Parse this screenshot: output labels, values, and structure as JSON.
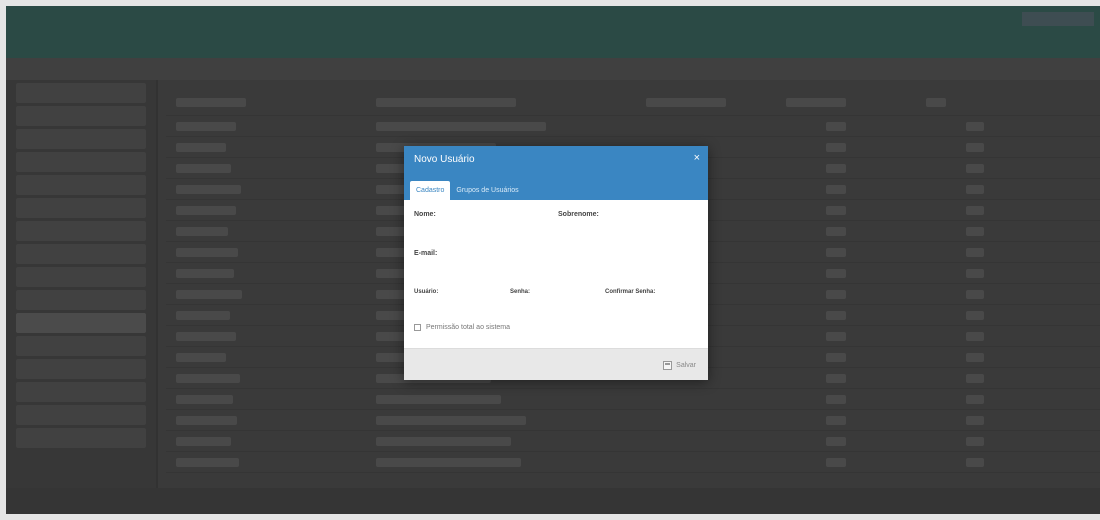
{
  "modal": {
    "title": "Novo Usuário",
    "close_glyph": "×",
    "tabs": [
      {
        "label": "Cadastro",
        "active": true
      },
      {
        "label": "Grupos de Usuários",
        "active": false
      }
    ],
    "fields": {
      "nome": {
        "label": "Nome:",
        "value": ""
      },
      "sobrenome": {
        "label": "Sobrenome:",
        "value": ""
      },
      "email": {
        "label": "E-mail:",
        "value": ""
      },
      "usuario": {
        "label": "Usuário:",
        "value": ""
      },
      "senha": {
        "label": "Senha:",
        "value": ""
      },
      "confirmar_senha": {
        "label": "Confirmar Senha:",
        "value": ""
      }
    },
    "checkbox": {
      "label": "Permissão total ao sistema",
      "checked": false
    },
    "save_label": "Salvar"
  },
  "colors": {
    "header_blue": "#3a86c2",
    "topbar": "#2e4f49",
    "backdrop": "#3e3e3e"
  },
  "icons": [
    "close-icon",
    "save-icon"
  ]
}
